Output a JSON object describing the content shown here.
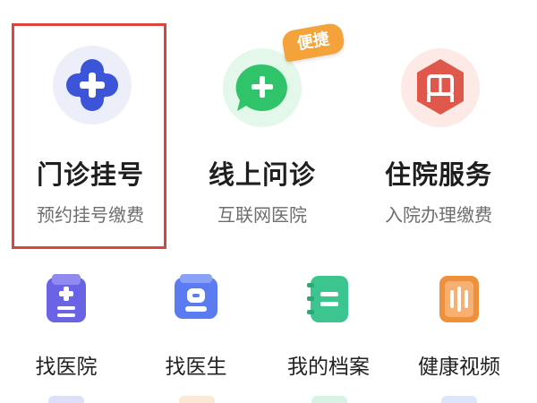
{
  "services": [
    {
      "title": "门诊挂号",
      "subtitle": "预约挂号缴费",
      "icon": "medical-cross-icon",
      "selected": true
    },
    {
      "title": "线上问诊",
      "subtitle": "互联网医院",
      "icon": "chat-plus-icon",
      "badge": "便捷"
    },
    {
      "title": "住院服务",
      "subtitle": "入院办理缴费",
      "icon": "hospital-bed-icon"
    }
  ],
  "shortcuts": [
    {
      "label": "找医院",
      "icon": "hospital-building-icon"
    },
    {
      "label": "找医生",
      "icon": "doctor-icon"
    },
    {
      "label": "我的档案",
      "icon": "records-notebook-icon"
    },
    {
      "label": "健康视频",
      "icon": "video-book-icon"
    }
  ],
  "colors": {
    "selection_border": "#d8463d",
    "badge": "#f3a33a",
    "blue_icon": "#3b54d8",
    "green_icon": "#2fc46a",
    "red_icon": "#e0584c",
    "purple_icon": "#6a63e6",
    "teal_icon": "#3dc58f",
    "orange_icon": "#f0903a"
  }
}
